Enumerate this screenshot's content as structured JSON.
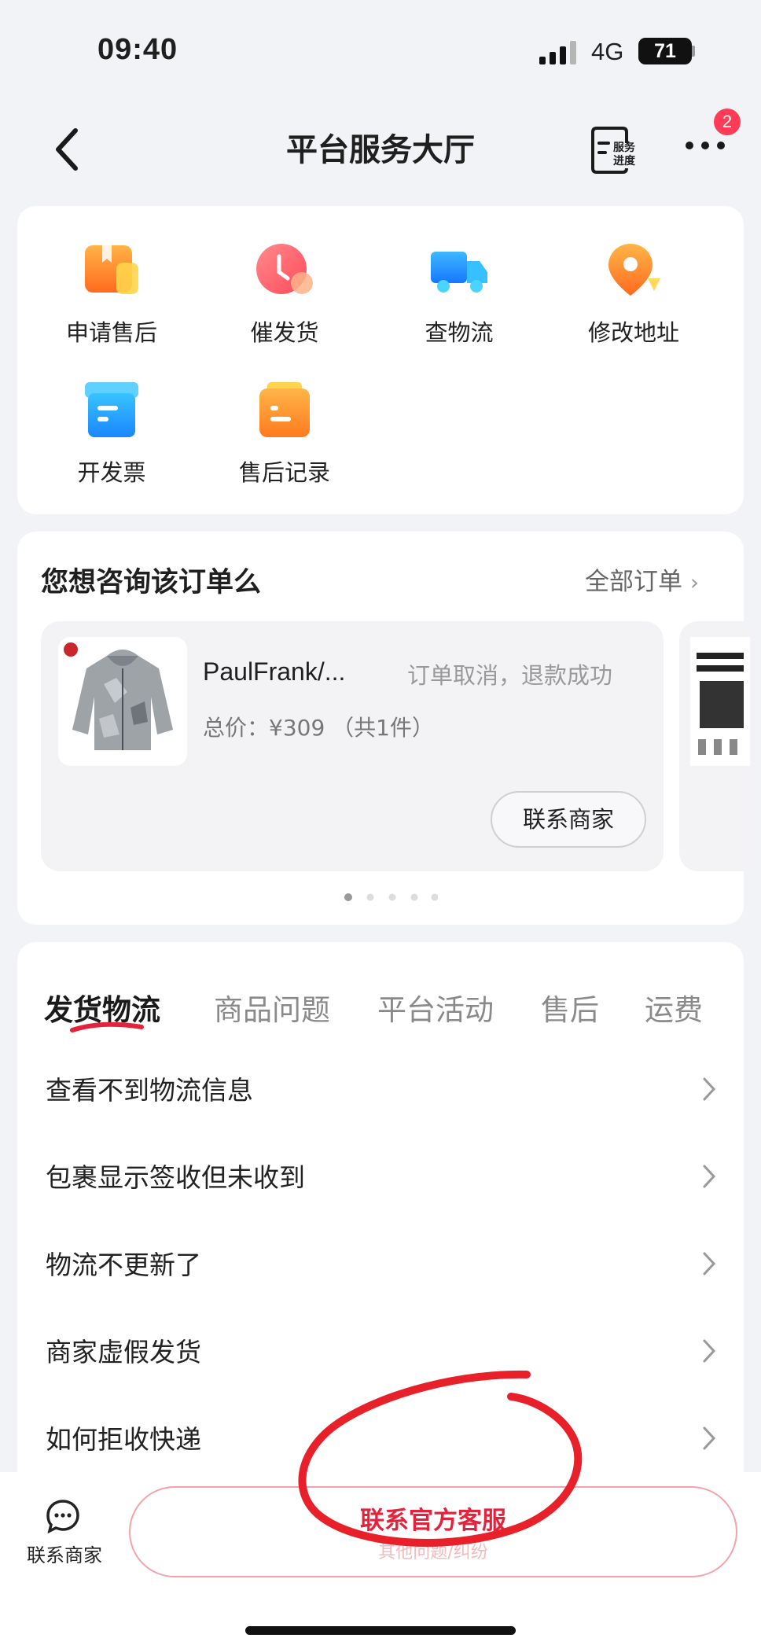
{
  "status_bar": {
    "time": "09:40",
    "network": "4G",
    "battery": "71"
  },
  "nav": {
    "title": "平台服务大厅",
    "progress_label_line1": "服务",
    "progress_label_line2": "进度",
    "badge_count": "2"
  },
  "services": [
    {
      "label": "申请售后",
      "icon": "box-icon"
    },
    {
      "label": "催发货",
      "icon": "clock-icon"
    },
    {
      "label": "查物流",
      "icon": "truck-icon"
    },
    {
      "label": "修改地址",
      "icon": "location-pin-icon"
    },
    {
      "label": "开发票",
      "icon": "invoice-icon"
    },
    {
      "label": "售后记录",
      "icon": "record-icon"
    }
  ],
  "order_section": {
    "title": "您想咨询该订单么",
    "all_orders": "全部订单",
    "order": {
      "name": "PaulFrank/...",
      "status": "订单取消，退款成功",
      "price": "总价：¥309 （共1件）",
      "contact_button": "联系商家"
    },
    "pager_count": 5,
    "pager_active": 0
  },
  "faq": {
    "tabs": [
      "发货物流",
      "商品问题",
      "平台活动",
      "售后",
      "运费"
    ],
    "active_tab": 0,
    "items": [
      "查看不到物流信息",
      "包裹显示签收但未收到",
      "物流不更新了",
      "商家虚假发货",
      "如何拒收快递"
    ]
  },
  "bottom_bar": {
    "contact_merchant": "联系商家",
    "official_service": "联系官方客服",
    "official_service_sub": "其他问题/纠纷"
  },
  "colors": {
    "accent": "#e5223c",
    "background": "#f2f3f7",
    "card": "#ffffff",
    "badge": "#ff3b57",
    "annotation": "#e8202a"
  }
}
